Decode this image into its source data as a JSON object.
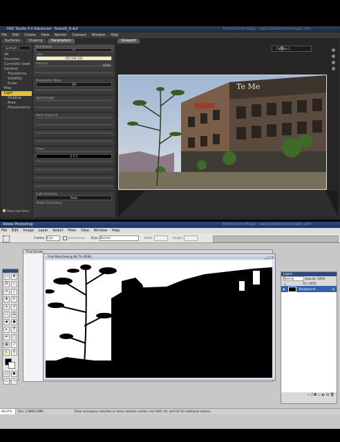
{
  "watermark": "Architectural Magic : www.tanakilsonthemagic.com",
  "daz": {
    "title": "DAZ Studio 4.0 Advanced - Scene5_8.duf",
    "menu": [
      "File",
      "Edit",
      "Create",
      "View",
      "Render",
      "Connect",
      "Window",
      "Help"
    ],
    "left_tabs": [
      "Parameters",
      "Viewport"
    ],
    "panel_tabs": [
      "Surfaces",
      "Shaping",
      "Parameters"
    ],
    "scene_dropdown": "Spotlight 1",
    "tree": [
      "All",
      "Favorites",
      "Currently Used",
      "General",
      "Transforms",
      "Visibility",
      "Scale",
      "Misc",
      "Light",
      "Shadow",
      "Area",
      "Photometrics"
    ],
    "tree_selected": "Light",
    "props": [
      {
        "label": "Illumination",
        "value": "On"
      },
      {
        "label": "Color",
        "value": "255   244   222"
      },
      {
        "label": "Intensity",
        "value": "164%"
      },
      {
        "label": "Photometric Mode",
        "value": "Off"
      },
      {
        "label": "Spread Angle",
        "value": ""
      },
      {
        "label": "Beam Exponent",
        "value": ""
      },
      {
        "label": "Flares",
        "value": "0   0   0"
      },
      {
        "label": "Light Geometry",
        "value": "Point"
      },
      {
        "label": "Height (Geometry)",
        "value": ""
      }
    ],
    "show_sub_items": "Show Sub Items",
    "viewport_tab": "Viewport",
    "camera_dropdown": "Camera 1",
    "sign_text": "Te Me"
  },
  "ps": {
    "title": "Adobe Photoshop",
    "menu": [
      "File",
      "Edit",
      "Image",
      "Layer",
      "Select",
      "Filter",
      "View",
      "Window",
      "Help"
    ],
    "options": {
      "feather_label": "Feather:",
      "feather_value": "0 px",
      "antialias": "Anti-aliased",
      "style_label": "Style:",
      "style_value": "Normal",
      "width_label": "Width:",
      "height_label": "Height:"
    },
    "back_doc_title": "Final Render...",
    "doc_title": "Final Mask.bmp @ 66.7% (RGB)",
    "layers_panel_title": "Layers",
    "layer_mode": "Normal",
    "opacity_label": "Opacity:",
    "opacity_value": "100%",
    "fill_label": "Fill:",
    "fill_value": "100%",
    "layer_name": "Background",
    "zoom": "66.67%",
    "doc_size": "Doc: 3.08M/3.08M",
    "status_hint": "Draw rectangular selection or move selection outline. Use Shift, Alt, and Ctrl for additional options."
  }
}
